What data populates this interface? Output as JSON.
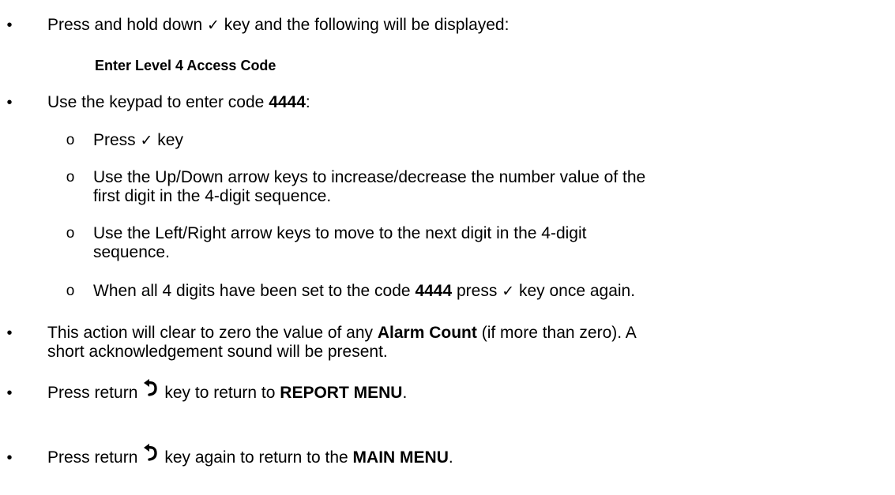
{
  "bullet_glyph": "•",
  "sub_bullet_glyph": "o",
  "check_glyph": "✓",
  "icons": {
    "check": "check-mark-icon",
    "return": "return-arrow-icon"
  },
  "steps": {
    "step1": {
      "pre": "Press and hold down ",
      "post": " key and the following will be displayed:"
    },
    "display_message": "Enter Level 4 Access Code",
    "step2": {
      "pre": "Use the keypad to enter code ",
      "code": "4444",
      "post": ":"
    },
    "sub1": {
      "pre": "Press ",
      "post": " key"
    },
    "sub2": {
      "line1": "Use the Up/Down arrow keys to increase/decrease the number value of the",
      "line2": "first digit in the 4-digit sequence."
    },
    "sub3": {
      "line1": "Use the Left/Right arrow keys to move to the next digit in the 4-digit",
      "line2": "sequence."
    },
    "sub4": {
      "pre": "When all 4 digits have been set to the code ",
      "code": "4444",
      "mid": " press ",
      "post": " key once again."
    },
    "step3": {
      "pre": "This action will clear to zero the value of any ",
      "term": "Alarm Count",
      "post": " (if more than zero). A",
      "line2": "short acknowledgement sound will be present."
    },
    "step4": {
      "pre": "Press return",
      "post": "key to return to ",
      "target": "REPORT MENU",
      "end": "."
    },
    "step5": {
      "pre": "Press return",
      "post": "key again to return to the ",
      "target": "MAIN MENU",
      "end": "."
    }
  }
}
